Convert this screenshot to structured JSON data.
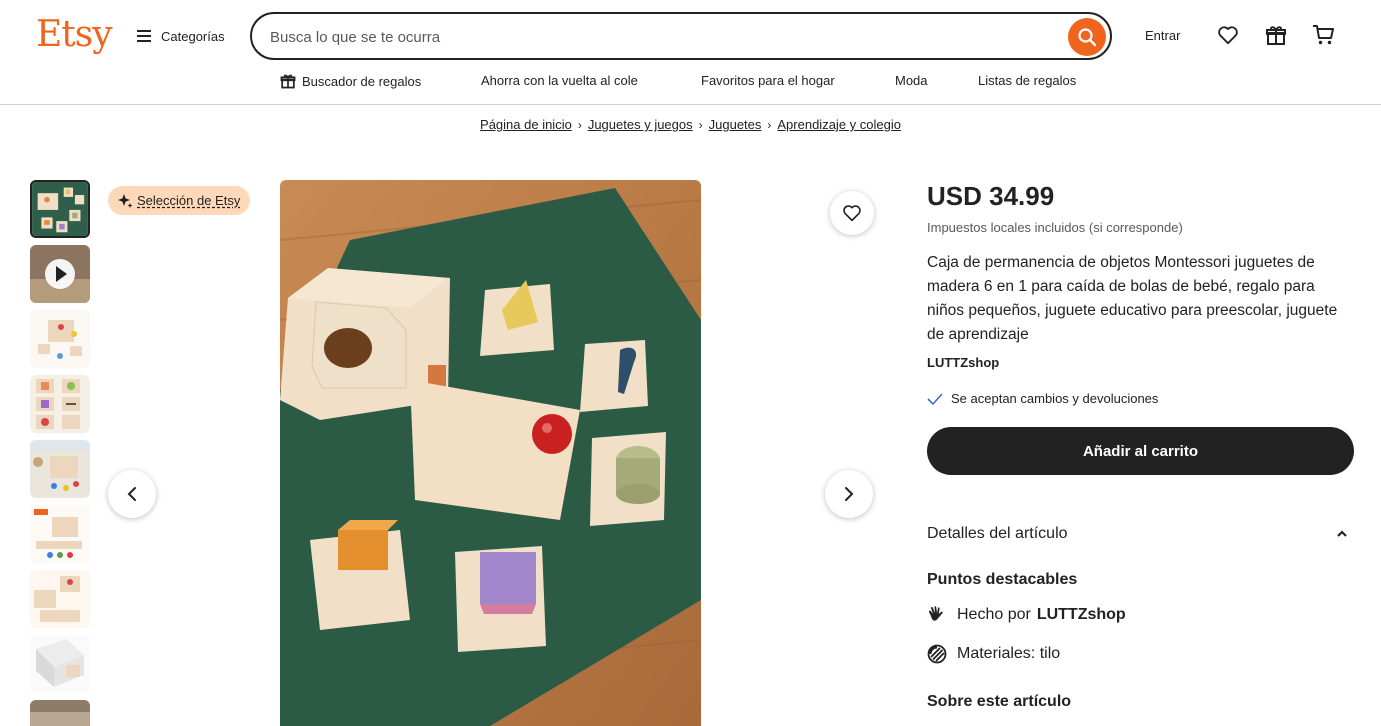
{
  "brand": {
    "logo": "Etsy",
    "accent_color": "#f1641e"
  },
  "header": {
    "categories_label": "Categorías",
    "search": {
      "placeholder": "Busca lo que se te ocurra",
      "value": ""
    },
    "signin_label": "Entrar",
    "icons": [
      "heart-icon",
      "gift-icon",
      "cart-icon"
    ]
  },
  "nav": {
    "items": [
      {
        "label": "Buscador de regalos",
        "icon": "gift-icon"
      },
      {
        "label": "Ahorra con la vuelta al cole"
      },
      {
        "label": "Favoritos para el hogar"
      },
      {
        "label": "Moda"
      },
      {
        "label": "Listas de regalos"
      }
    ]
  },
  "breadcrumb": [
    "Página de inicio",
    "Juguetes y juegos",
    "Juguetes",
    "Aprendizaje y colegio"
  ],
  "gallery": {
    "badge": "Selección de Etsy",
    "thumbnail_count": 9,
    "active_thumbnail": 1
  },
  "product": {
    "price": "USD 34.99",
    "taxes_note": "Impuestos locales incluidos (si corresponde)",
    "title": "Caja de permanencia de objetos Montessori juguetes de madera 6 en 1 para caída de bolas de bebé, regalo para niños pequeños, juguete educativo para preescolar, juguete de aprendizaje",
    "shop_name": "LUTTZshop",
    "returns_note": "Se aceptan cambios y devoluciones",
    "add_to_cart_label": "Añadir al carrito",
    "details_heading": "Detalles del artículo",
    "highlights_heading": "Puntos destacables",
    "made_by_prefix": "Hecho por",
    "made_by_shop": "LUTTZshop",
    "materials": "Materiales: tilo",
    "about_heading": "Sobre este artículo"
  }
}
